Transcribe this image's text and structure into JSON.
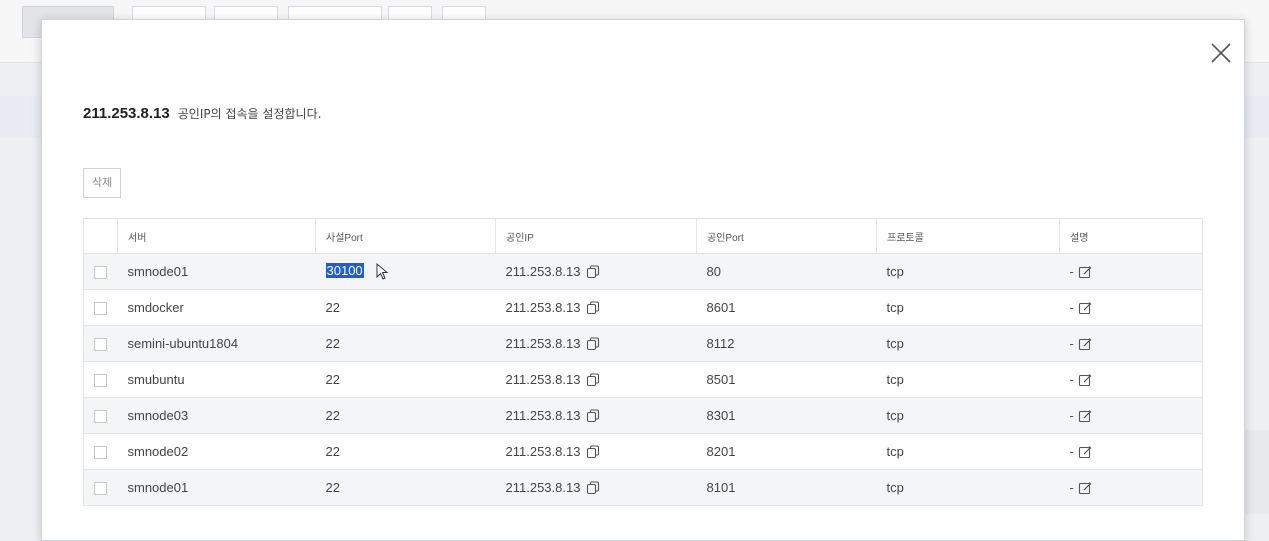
{
  "modal": {
    "title_ip": "211.253.8.13",
    "title_desc": "공인IP의 접속을 설정합니다.",
    "delete_label": "삭제"
  },
  "table": {
    "headers": [
      "서버",
      "사설Port",
      "공인IP",
      "공인Port",
      "프로토콜",
      "설명"
    ],
    "rows": [
      {
        "server": "smnode01",
        "private_port": "30100",
        "public_ip": "211.253.8.13",
        "public_port": "80",
        "protocol": "tcp",
        "desc": "-"
      },
      {
        "server": "smdocker",
        "private_port": "22",
        "public_ip": "211.253.8.13",
        "public_port": "8601",
        "protocol": "tcp",
        "desc": "-"
      },
      {
        "server": "semini-ubuntu1804",
        "private_port": "22",
        "public_ip": "211.253.8.13",
        "public_port": "8112",
        "protocol": "tcp",
        "desc": "-"
      },
      {
        "server": "smubuntu",
        "private_port": "22",
        "public_ip": "211.253.8.13",
        "public_port": "8501",
        "protocol": "tcp",
        "desc": "-"
      },
      {
        "server": "smnode03",
        "private_port": "22",
        "public_ip": "211.253.8.13",
        "public_port": "8301",
        "protocol": "tcp",
        "desc": "-"
      },
      {
        "server": "smnode02",
        "private_port": "22",
        "public_ip": "211.253.8.13",
        "public_port": "8201",
        "protocol": "tcp",
        "desc": "-"
      },
      {
        "server": "smnode01",
        "private_port": "22",
        "public_ip": "211.253.8.13",
        "public_port": "8101",
        "protocol": "tcp",
        "desc": "-"
      }
    ]
  },
  "icons": {
    "close": "close-icon",
    "copy": "copy-icon",
    "edit": "edit-icon",
    "checkbox": "checkbox"
  },
  "colors": {
    "selection": "#1e5fd0",
    "border": "#e3e5e9"
  }
}
